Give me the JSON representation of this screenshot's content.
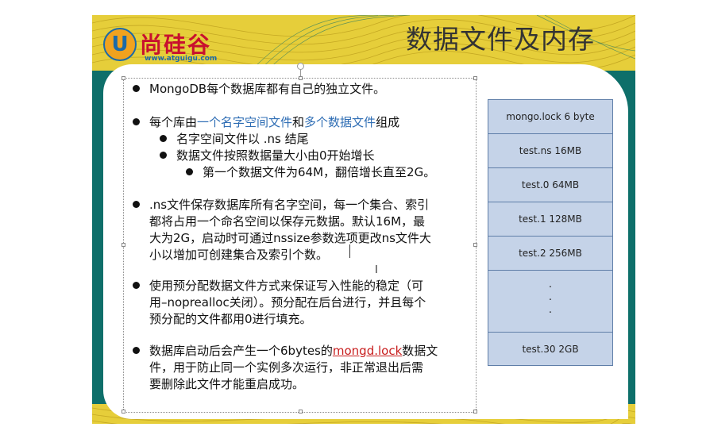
{
  "slide": {
    "title": "数据文件及内存",
    "logo": {
      "letter": "U",
      "name": "尚硅谷",
      "url": "www.atguigu.com"
    }
  },
  "bullets": [
    {
      "text": "MongoDB每个数据库都有自己的独立文件。"
    },
    {
      "pre": "每个库由",
      "link1": "一个名字空间文件",
      "mid": "和",
      "link2": "多个数据文件",
      "post": "组成"
    },
    {
      "text": "名字空间文件以 .ns 结尾"
    },
    {
      "text": "数据文件按照数据量大小由0开始增长"
    },
    {
      "text": "第一个数据文件为64M，翻倍增长直至2G。"
    },
    {
      "lines": [
        ".ns文件保存数据库所有名字空间，每一个集合、索引",
        "都将占用一个命名空间以保存元数据。默认16M，最",
        "大为2G，启动时可通过nssize参数选项更改ns文件大",
        "小以增加可创建集合及索引个数。"
      ]
    },
    {
      "lines": [
        "使用预分配数据文件方式来保证写入性能的稳定（可",
        "用–noprealloc关闭）。预分配在后台进行，并且每个",
        "预分配的文件都用0进行填充。"
      ]
    },
    {
      "pre": "数据库启动后会产生一个6bytes的",
      "link": "mongd.lock",
      "post": "数据文",
      "lines": [
        "件，用于防止同一个实例多次运行，非正常退出后需",
        "要删除此文件才能重启成功。"
      ]
    }
  ],
  "file_stack": [
    "mongo.lock 6 byte",
    "test.ns 16MB",
    "test.0 64MB",
    "test.1 128MB",
    "test.2 256MB",
    "·",
    "·",
    "·",
    "test.30 2GB"
  ],
  "colors": {
    "teal": "#0e6f6a",
    "cell": "#c5d3e8",
    "link_blue": "#2e6db4",
    "link_red": "#c81e1e"
  }
}
